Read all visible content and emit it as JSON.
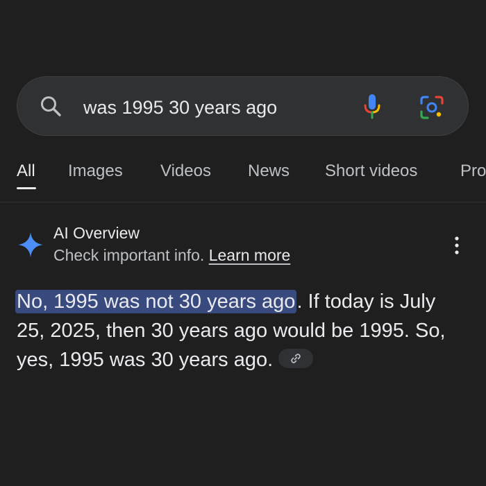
{
  "search": {
    "query": "was 1995 30 years ago"
  },
  "tabs": [
    {
      "label": "All",
      "active": true
    },
    {
      "label": "Images"
    },
    {
      "label": "Videos"
    },
    {
      "label": "News"
    },
    {
      "label": "Short videos"
    },
    {
      "label": "Pro"
    }
  ],
  "ai_overview": {
    "title": "AI Overview",
    "subtitle": "Check important info.",
    "learn_more": "Learn more",
    "answer_highlight": "No, 1995 was not 30 years ago",
    "answer_rest": ". If today is July 25, 2025, then 30 years ago would be 1995. So, yes, 1995 was 30 years ago."
  },
  "colors": {
    "background": "#1f1f1f",
    "search_bg": "#2f3133",
    "highlight": "#394a7e",
    "text": "#e8eaed",
    "sparkle": "#4c8df6"
  }
}
